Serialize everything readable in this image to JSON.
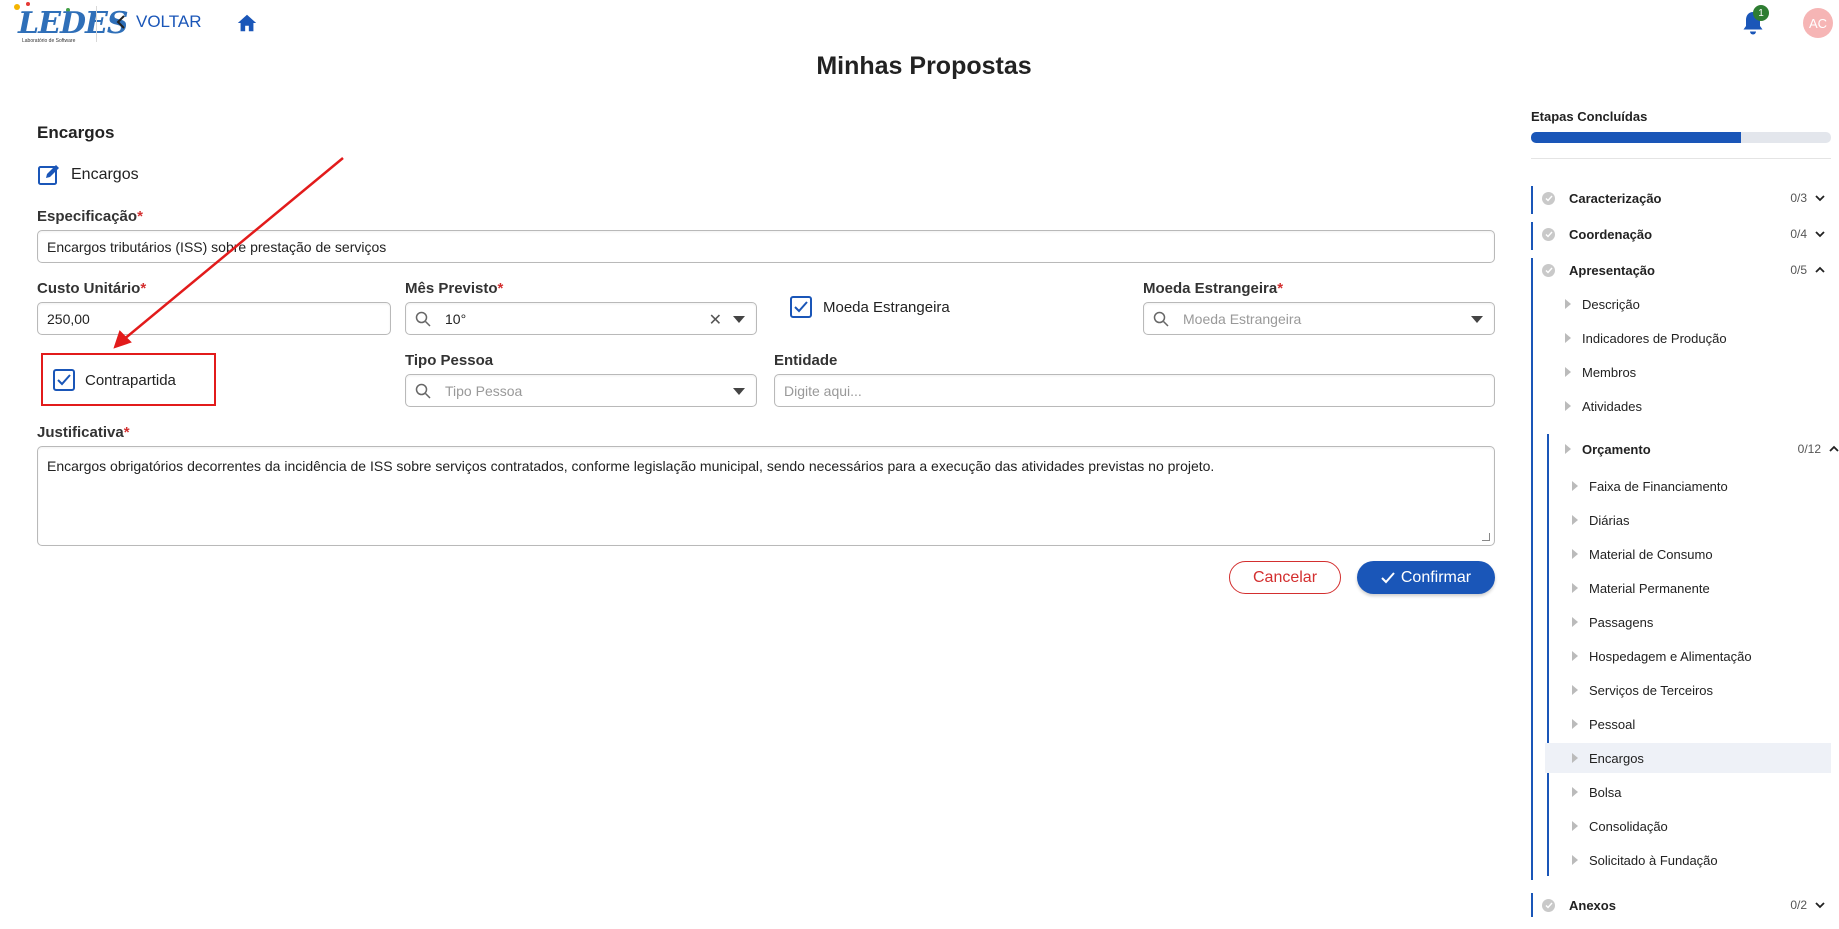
{
  "header": {
    "logo_text": "LEDES",
    "logo_subtitle": "Laboratório de Software",
    "back_label": "VOLTAR",
    "notification_count": "1",
    "avatar_initials": "AC"
  },
  "page_title": "Minhas Propostas",
  "form": {
    "section_title": "Encargos",
    "subtitle": "Encargos",
    "especificacao_label": "Especificação",
    "especificacao_value": "Encargos tributários (ISS) sobre prestação de serviços",
    "custo_label": "Custo Unitário",
    "custo_value": "250,00",
    "mes_label": "Mês Previsto",
    "mes_value": "10°",
    "moeda_checkbox_label": "Moeda Estrangeira",
    "moeda_label": "Moeda Estrangeira",
    "moeda_placeholder": "Moeda Estrangeira",
    "contrapartida_label": "Contrapartida",
    "tipo_pessoa_label": "Tipo Pessoa",
    "tipo_pessoa_placeholder": "Tipo Pessoa",
    "entidade_label": "Entidade",
    "entidade_placeholder": "Digite aqui...",
    "justificativa_label": "Justificativa",
    "justificativa_value": "Encargos obrigatórios decorrentes da incidência de ISS sobre serviços contratados, conforme legislação municipal, sendo necessários para a execução das atividades previstas no projeto.",
    "required_mark": "*",
    "cancel_label": "Cancelar",
    "confirm_label": "Confirmar"
  },
  "stages": {
    "title": "Etapas Concluídas",
    "progress_fraction": 0.7,
    "caracterizacao": {
      "label": "Caracterização",
      "count": "0/3"
    },
    "coordenacao": {
      "label": "Coordenação",
      "count": "0/4"
    },
    "apresentacao": {
      "label": "Apresentação",
      "count": "0/5"
    },
    "apresentacao_items": [
      "Descrição",
      "Indicadores de Produção",
      "Membros",
      "Atividades"
    ],
    "orcamento": {
      "label": "Orçamento",
      "count": "0/12"
    },
    "orcamento_items": [
      "Faixa de Financiamento",
      "Diárias",
      "Material de Consumo",
      "Material Permanente",
      "Passagens",
      "Hospedagem e Alimentação",
      "Serviços de Terceiros",
      "Pessoal",
      "Encargos",
      "Bolsa",
      "Consolidação",
      "Solicitado à Fundação"
    ],
    "anexos": {
      "label": "Anexos",
      "count": "0/2"
    }
  },
  "colors": {
    "primary": "#1a56b8",
    "danger": "#d32f2f",
    "annotation": "#e21b1b"
  }
}
